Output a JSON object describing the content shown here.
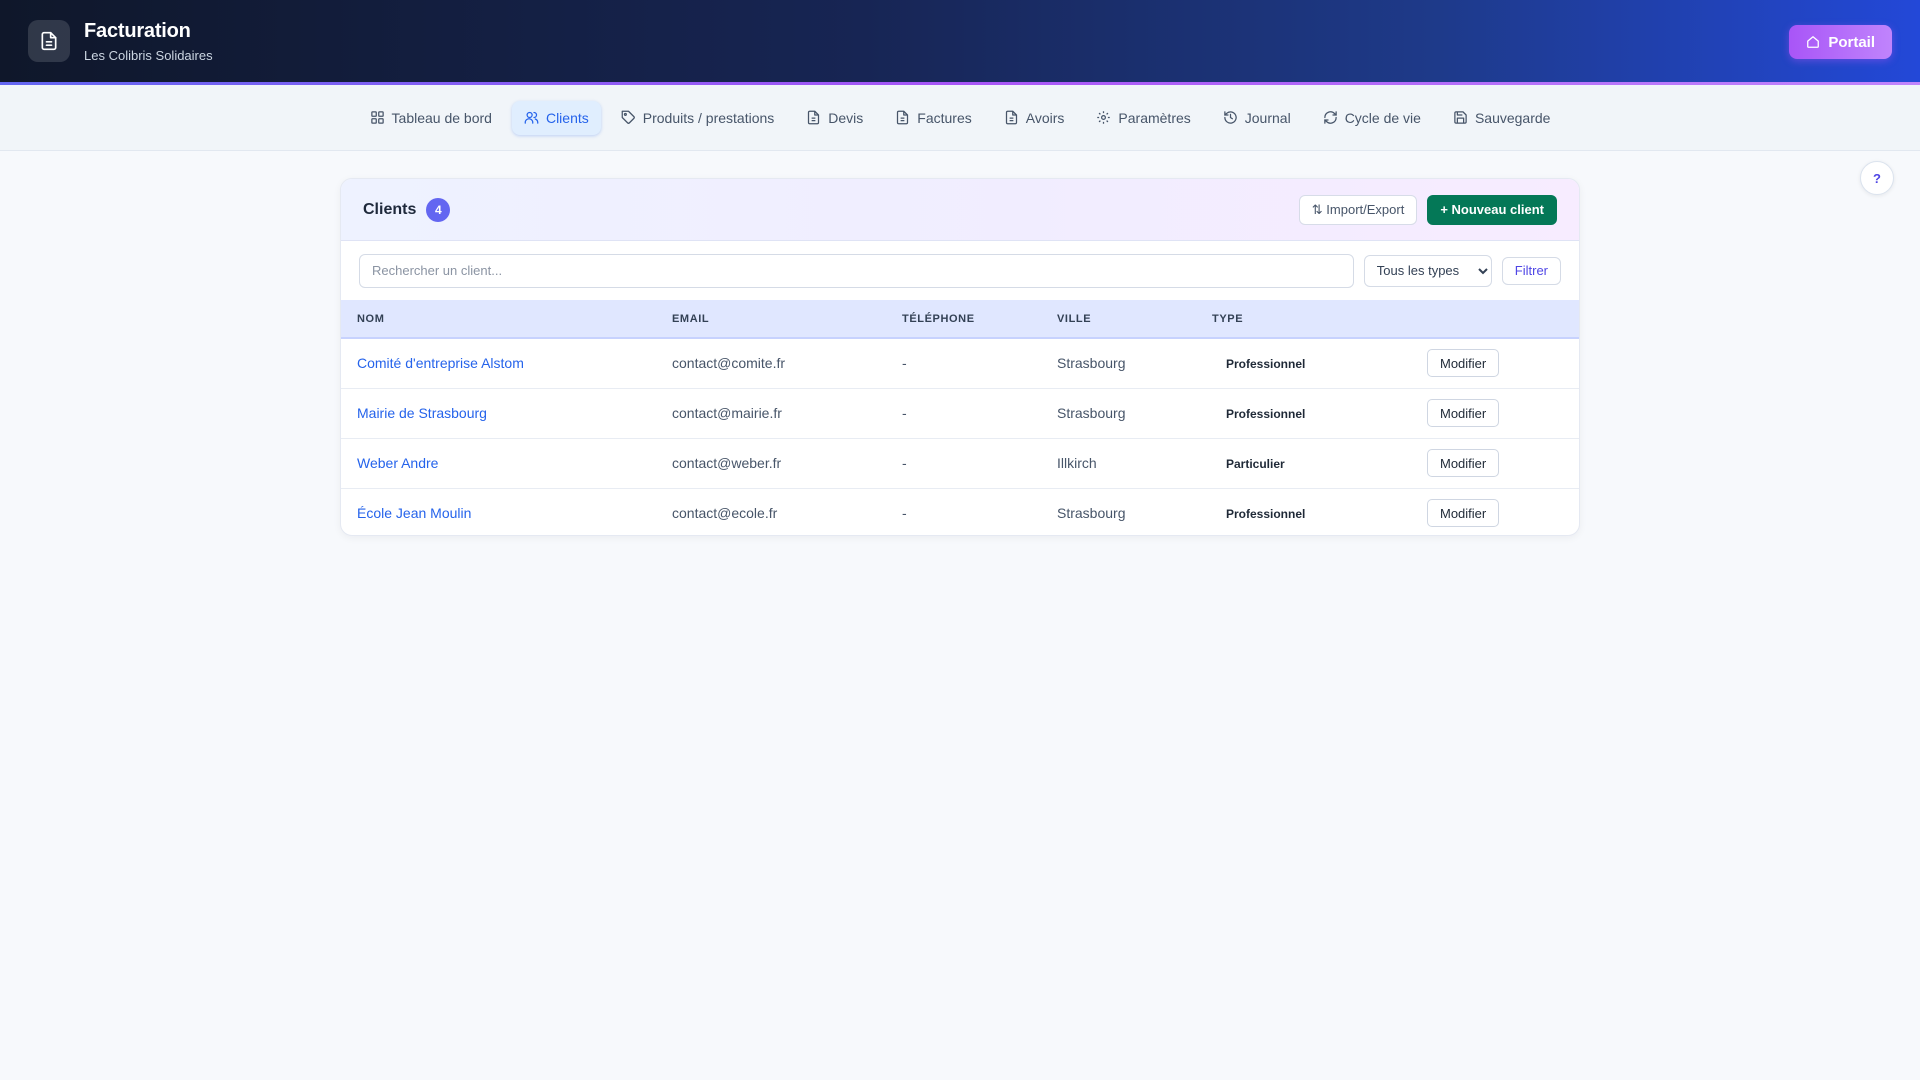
{
  "header": {
    "title": "Facturation",
    "subtitle": "Les Colibris Solidaires",
    "icon": "file-text-icon",
    "portail_label": "Portail",
    "portail_icon": "home-icon"
  },
  "nav": {
    "items": [
      {
        "label": "Tableau de bord",
        "icon": "grid-icon",
        "active": false
      },
      {
        "label": "Clients",
        "icon": "users-icon",
        "active": true
      },
      {
        "label": "Produits / prestations",
        "icon": "tag-icon",
        "active": false
      },
      {
        "label": "Devis",
        "icon": "document-icon",
        "active": false
      },
      {
        "label": "Factures",
        "icon": "document-icon",
        "active": false
      },
      {
        "label": "Avoirs",
        "icon": "document-icon",
        "active": false
      },
      {
        "label": "Paramètres",
        "icon": "gear-icon",
        "active": false
      },
      {
        "label": "Journal",
        "icon": "history-icon",
        "active": false
      },
      {
        "label": "Cycle de vie",
        "icon": "refresh-icon",
        "active": false
      },
      {
        "label": "Sauvegarde",
        "icon": "save-icon",
        "active": false
      }
    ]
  },
  "help": {
    "label": "?"
  },
  "clients": {
    "title": "Clients",
    "count": "4",
    "import_export_label": "⇅ Import/Export",
    "new_client_label": "+ Nouveau client",
    "search": {
      "placeholder": "Rechercher un client...",
      "value": ""
    },
    "type_filter": {
      "selected": "Tous les types"
    },
    "filter_label": "Filtrer",
    "columns": [
      "NOM",
      "EMAIL",
      "TÉLÉPHONE",
      "VILLE",
      "TYPE",
      ""
    ],
    "modify_label": "Modifier",
    "rows": [
      {
        "name": "Comité d'entreprise Alstom",
        "email": "contact@comite.fr",
        "phone": "-",
        "city": "Strasbourg",
        "type": "Professionnel"
      },
      {
        "name": "Mairie de Strasbourg",
        "email": "contact@mairie.fr",
        "phone": "-",
        "city": "Strasbourg",
        "type": "Professionnel"
      },
      {
        "name": "Weber Andre",
        "email": "contact@weber.fr",
        "phone": "-",
        "city": "Illkirch",
        "type": "Particulier"
      },
      {
        "name": "École Jean Moulin",
        "email": "contact@ecole.fr",
        "phone": "-",
        "city": "Strasbourg",
        "type": "Professionnel"
      }
    ]
  },
  "colors": {
    "accent": "#2563eb",
    "primary_green": "#047857",
    "badge": "#6366f1",
    "portail": "#a855f7"
  }
}
